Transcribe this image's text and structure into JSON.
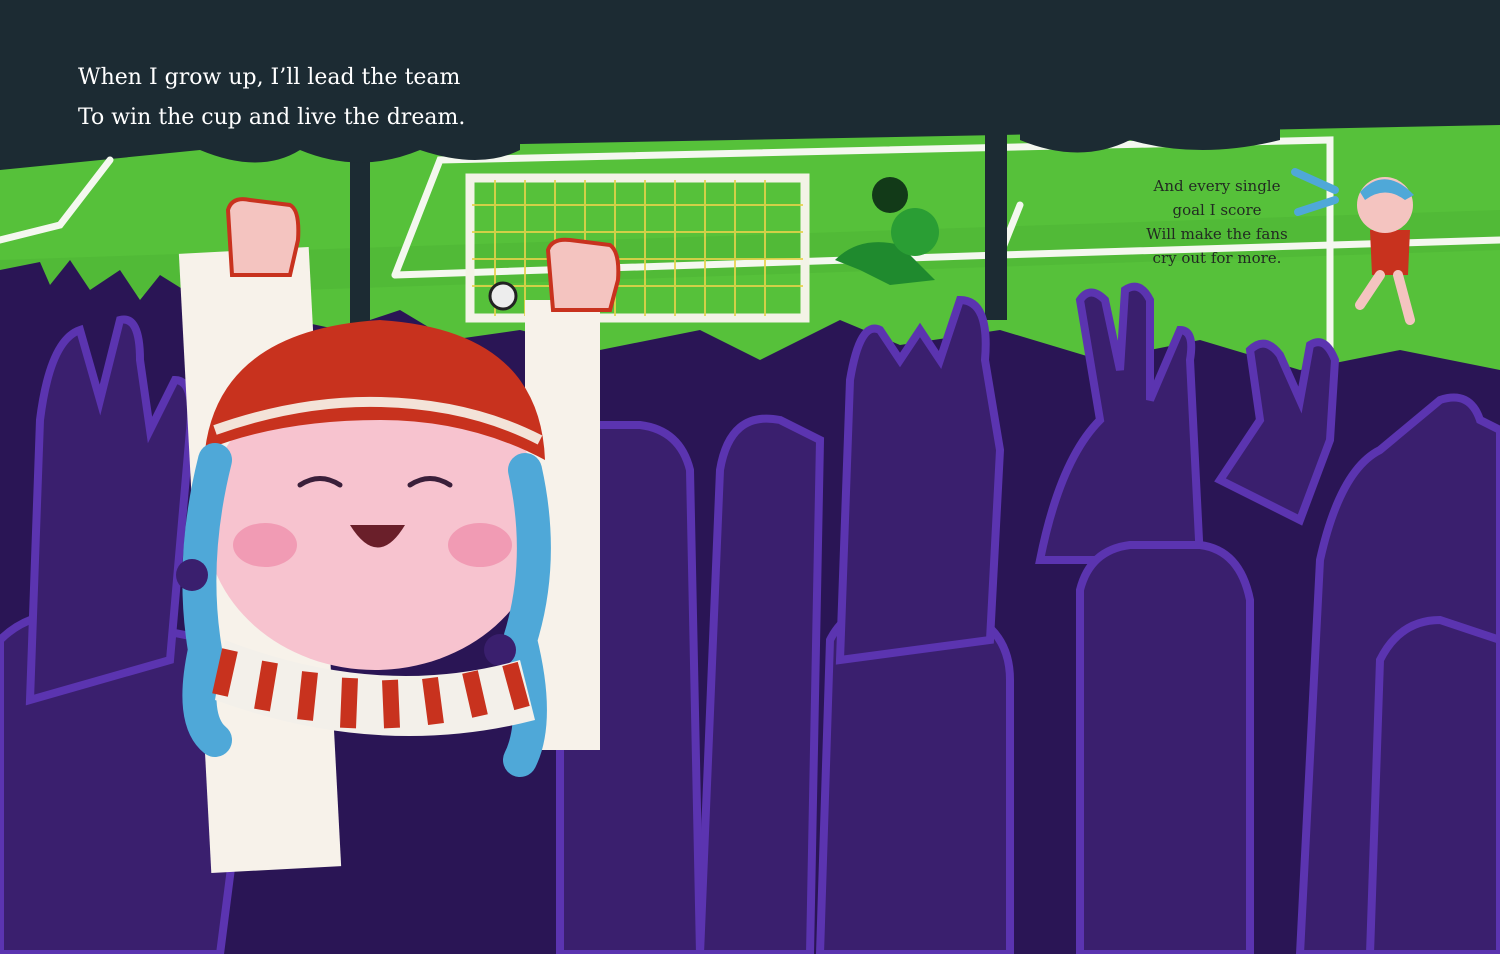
{
  "spread": {
    "verse_left": {
      "line1": "When I grow up, I’ll lead the team",
      "line2": "To win the cup and live the dream."
    },
    "verse_right": {
      "line1": "And every single",
      "line2": "goal I score",
      "line3": "Will make the fans",
      "line4": "cry out for more."
    }
  },
  "colors": {
    "night_sky": "#1c2b33",
    "pitch": "#56c13a",
    "crowd": "#3a1f6e",
    "crowd_outline": "#5b34b0",
    "hat_red": "#c8321e",
    "hair_blue": "#4fa8d8",
    "face_pink": "#f7c3cf"
  }
}
